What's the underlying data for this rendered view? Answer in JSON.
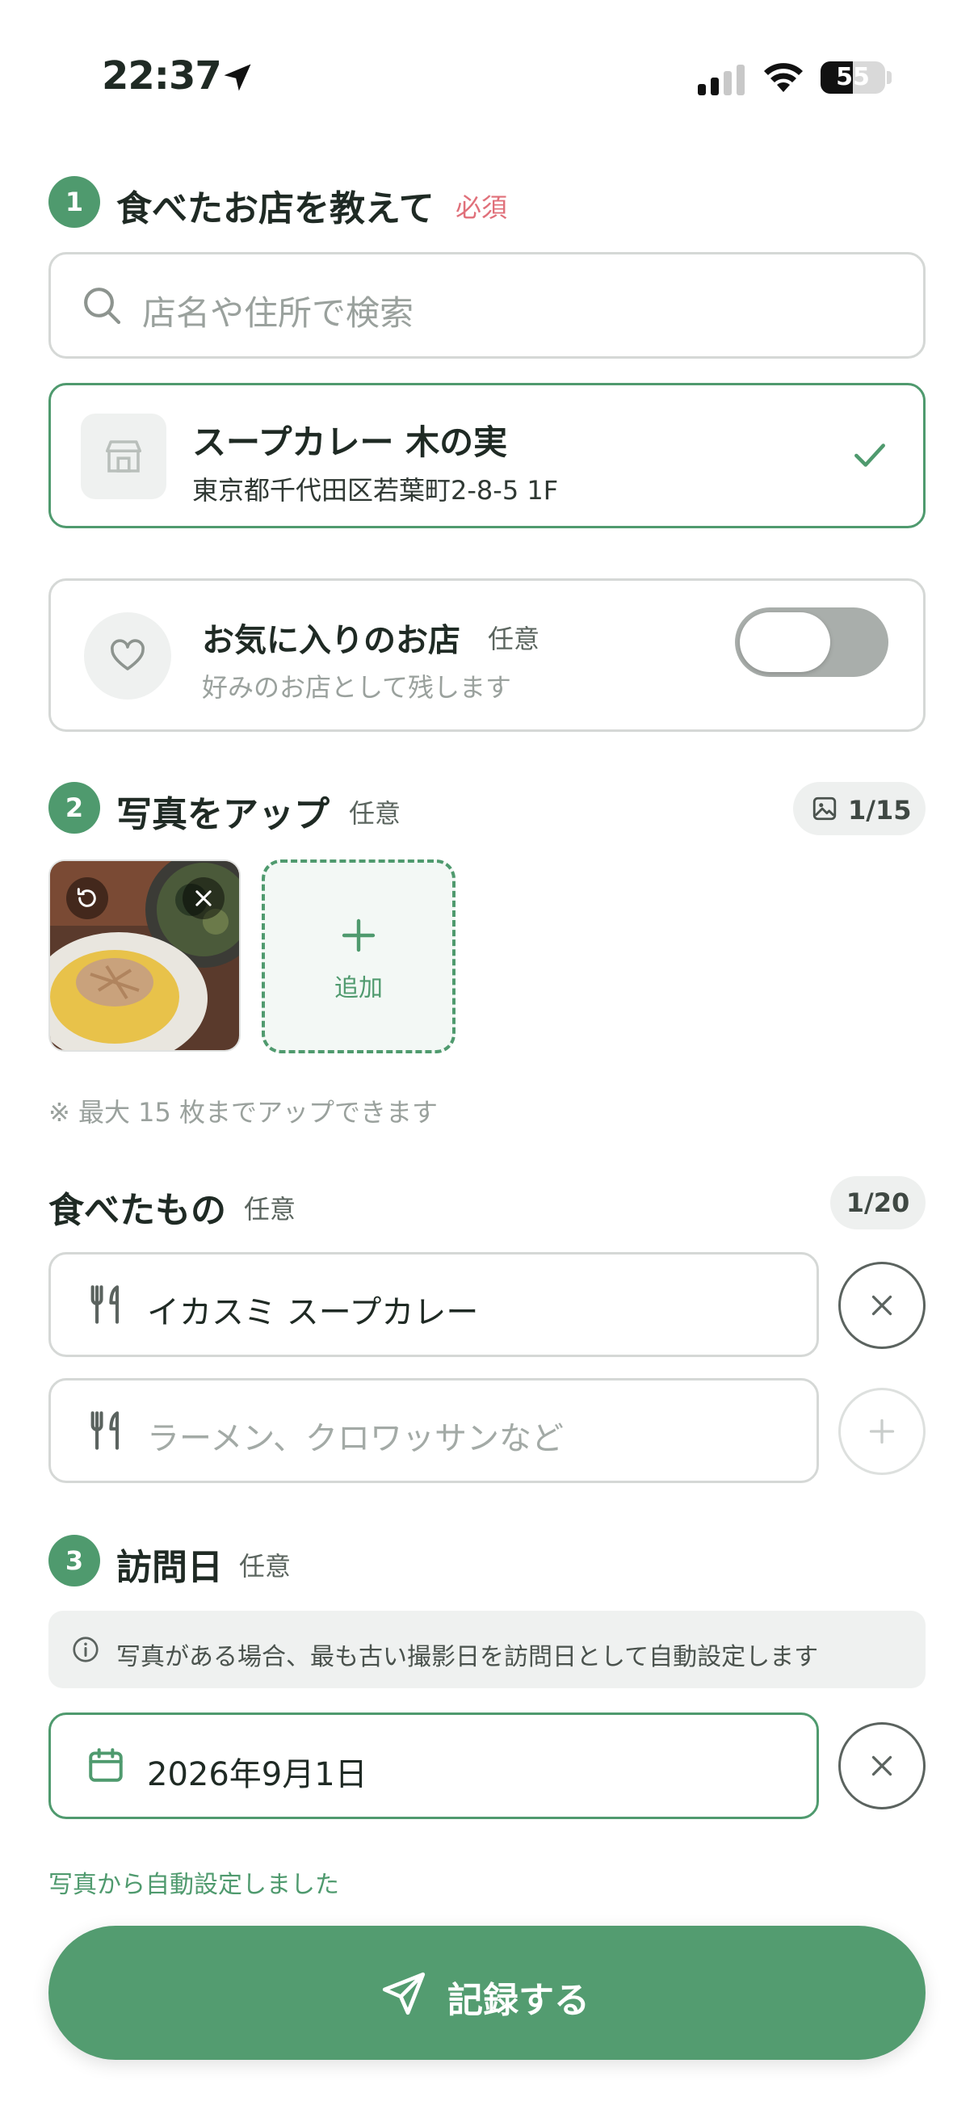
{
  "status_bar": {
    "time": "22:37",
    "battery": "55"
  },
  "section1": {
    "number": "1",
    "title": "食べたお店を教えて",
    "badge": "必須",
    "search_placeholder": "店名や住所で検索",
    "selected_store": {
      "name": "スープカレー 木の実",
      "address": "東京都千代田区若葉町2-8-5 1F"
    },
    "favorite": {
      "title": "お気に入りのお店",
      "badge": "任意",
      "subtitle": "好みのお店として残します",
      "enabled": false
    }
  },
  "section2": {
    "number": "2",
    "title": "写真をアップ",
    "badge": "任意",
    "photo_count": "1/15",
    "add_label": "追加",
    "note": "※ 最大 15 枚までアップできます"
  },
  "dishes": {
    "title": "食べたもの",
    "badge": "任意",
    "count": "1/20",
    "items": [
      {
        "value": "イカスミ スープカレー"
      }
    ],
    "placeholder": "ラーメン、クロワッサンなど"
  },
  "section3": {
    "number": "3",
    "title": "訪問日",
    "badge": "任意",
    "info": "写真がある場合、最も古い撮影日を訪問日として自動設定します",
    "date": "2026年9月1日",
    "auto_note": "写真から自動設定しました"
  },
  "submit": {
    "label": "記録する"
  },
  "colors": {
    "accent": "#4f9a6e",
    "required": "#e0707a",
    "border": "#d5d8d6"
  }
}
